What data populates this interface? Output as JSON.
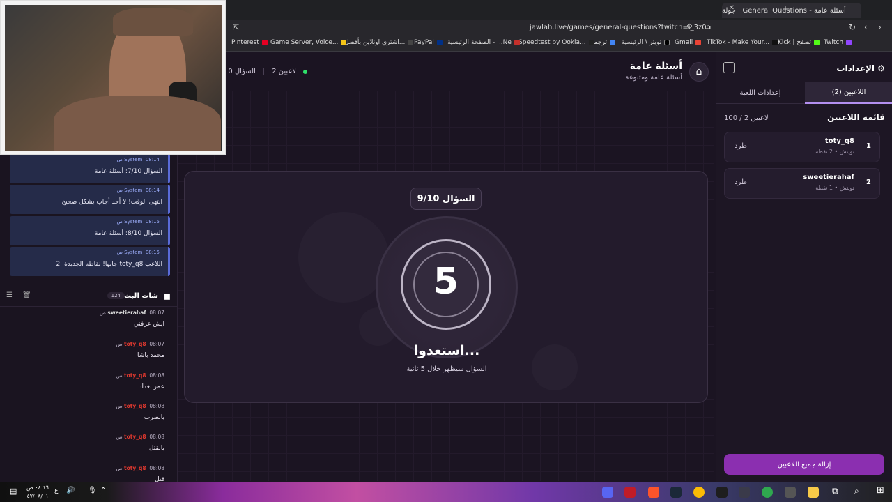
{
  "browser": {
    "tab_title": "أسئلة عامة - General Questions | جولة",
    "url": "jawlah.live/games/general-questions?twitch=i_3z0o",
    "bookmarks": [
      "Twitch",
      "Kick | تصفح",
      "TikTok - Make Your...",
      "Gmail",
      "تويتر \\ الرئيسية",
      "ترجمة",
      "Speedtest by Ookla...",
      "الصفحة الرئيسية - ...Ne",
      "PayPal",
      "اشتري اونلاين بأفضل...",
      "Game Server, Voice...",
      "Pinterest"
    ]
  },
  "header": {
    "title": "أسئلة عامة",
    "subtitle": "أسئلة عامة ومتنوعة",
    "players_online": "2 لاعبين",
    "question_counter": "السؤال 10"
  },
  "game": {
    "question_badge": "السؤال 9/10",
    "countdown": "5",
    "ready_text": "استعدوا...",
    "appear_text": "السؤال سيظهر خلال 5 ثانية"
  },
  "settings": {
    "title": "الإعدادات",
    "tab_players": "اللاعبين (2)",
    "tab_game_settings": "إعدادات اللعبة",
    "players_heading": "قائمة اللاعبين",
    "players_count": "100 / 2 لاعبين",
    "players": [
      {
        "rank": "1",
        "name": "toty_q8",
        "meta": "تويتش • 2 نقطة",
        "kick": "طرد"
      },
      {
        "rank": "2",
        "name": "sweetierahaf",
        "meta": "تويتش • 1 نقطة",
        "kick": "طرد"
      }
    ],
    "remove_all": "إزالة جميع اللاعبين"
  },
  "system_messages": [
    {
      "sender": "System",
      "time": "08:14 ص",
      "text": "السؤال 7/10: أسئلة عامة"
    },
    {
      "sender": "System",
      "time": "08:14 ص",
      "text": "انتهى الوقت! لا أحد أجاب بشكل صحيح"
    },
    {
      "sender": "System",
      "time": "08:15 ص",
      "text": "السؤال 8/10: أسئلة عامة"
    },
    {
      "sender": "System",
      "time": "08:15 ص",
      "text": "اللاعب toty_q8 جابها! نقاطه الجديدة: 2"
    }
  ],
  "chat": {
    "title": "شات البث",
    "count": "124",
    "messages": [
      {
        "user": "sweetierahaf",
        "time": "08:07 ص",
        "text": "ايش عرفني"
      },
      {
        "user": "toty_q8",
        "time": "08:07 ص",
        "text": "محمد باشا"
      },
      {
        "user": "toty_q8",
        "time": "08:08 ص",
        "text": "عمر بغداد"
      },
      {
        "user": "toty_q8",
        "time": "08:08 ص",
        "text": "بالضرب"
      },
      {
        "user": "toty_q8",
        "time": "08:08 ص",
        "text": "بالقتل"
      },
      {
        "user": "toty_q8",
        "time": "08:08 ص",
        "text": "قتل"
      }
    ]
  },
  "taskbar": {
    "time": "٠٨:١٦ ص",
    "date": "٤٧/٠٨/٠١",
    "lang": "ع"
  },
  "colors": {
    "accent": "#8b2fb0",
    "tab_underline": "#b38ff0",
    "online": "#2fe06a",
    "system_bg": "#252b49"
  }
}
